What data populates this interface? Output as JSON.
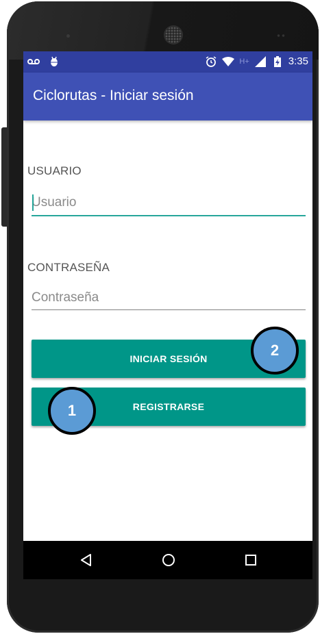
{
  "status_bar": {
    "time": "3:35",
    "network_type": "H+",
    "left_icons": [
      "voicemail-icon",
      "android-debug-icon"
    ],
    "right_icons": [
      "alarm-icon",
      "wifi-icon",
      "signal-icon",
      "battery-charging-icon"
    ]
  },
  "app_bar": {
    "title": "Ciclorutas - Iniciar sesión"
  },
  "form": {
    "user_label": "USUARIO",
    "user_placeholder": "Usuario",
    "user_value": "",
    "password_label": "CONTRASEÑA",
    "password_placeholder": "Contraseña",
    "password_value": "",
    "login_button": "INICIAR SESIÓN",
    "register_button": "REGISTRARSE"
  },
  "nav_bar": {
    "icons": [
      "back-icon",
      "home-icon",
      "recents-icon"
    ]
  },
  "annotations": {
    "callout_1": "1",
    "callout_2": "2"
  },
  "colors": {
    "status_bar": "#303f9f",
    "app_bar": "#3f51b5",
    "accent": "#009688",
    "callout": "#5b9bd5"
  }
}
